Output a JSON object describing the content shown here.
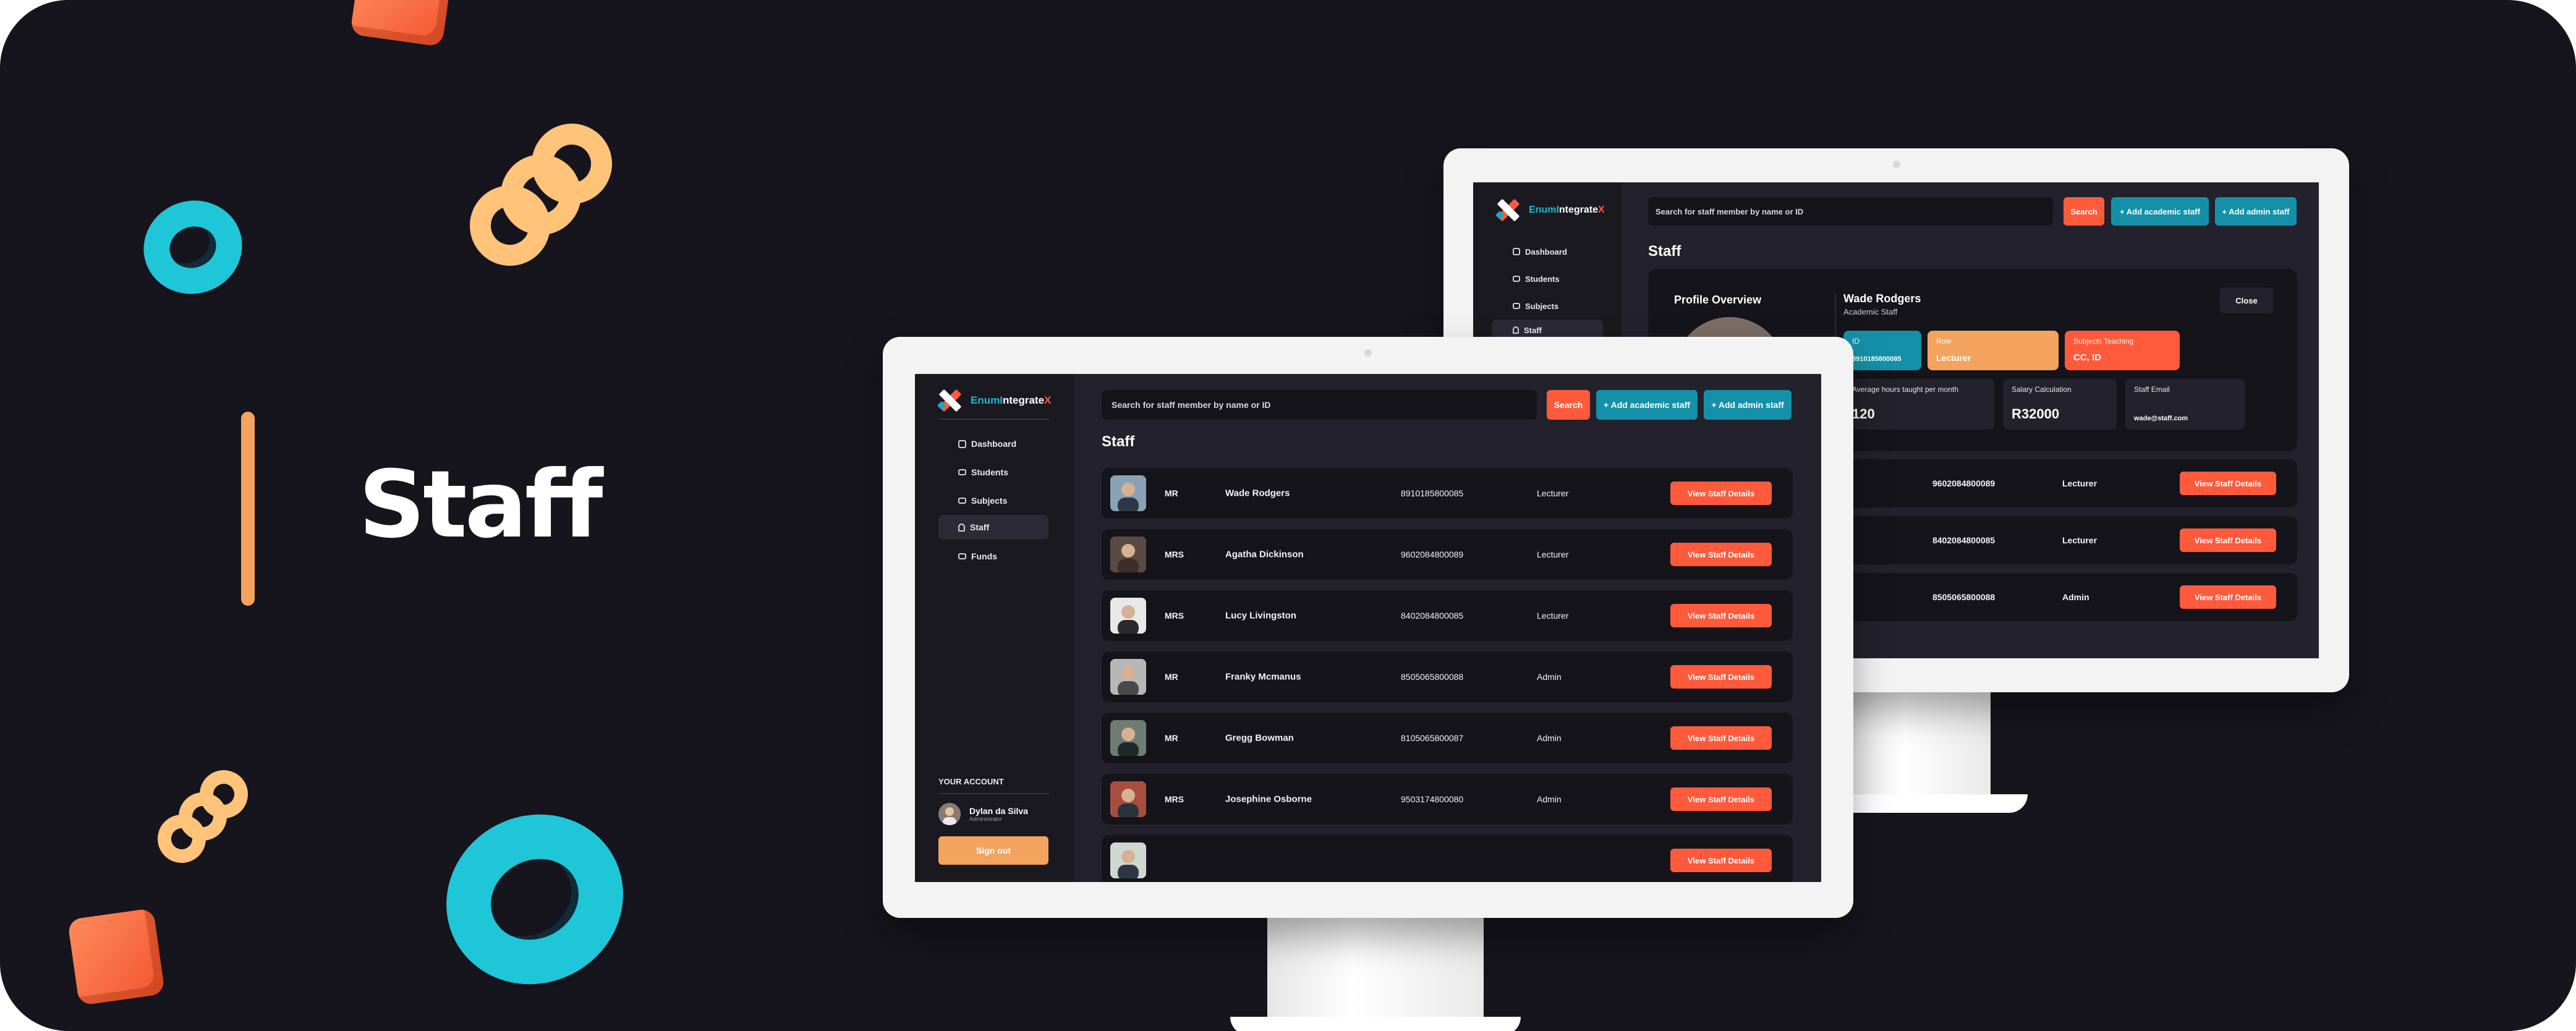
{
  "hero": {
    "title": "Staff"
  },
  "app": {
    "brand": {
      "part1": "Enum",
      "part2": "I",
      "part3": "ntegrate",
      "part4": "X"
    },
    "search": {
      "placeholder": "Search for staff member by name or ID",
      "button": "Search"
    },
    "actions": {
      "add_academic": "+ Add academic staff",
      "add_admin": "+ Add admin staff"
    },
    "page_title": "Staff",
    "nav": [
      {
        "label": "Dashboard",
        "icon": "grid-icon"
      },
      {
        "label": "Students",
        "icon": "graduation-cap-icon"
      },
      {
        "label": "Subjects",
        "icon": "book-icon"
      },
      {
        "label": "Staff",
        "icon": "person-icon"
      },
      {
        "label": "Funds",
        "icon": "wallet-icon"
      }
    ],
    "account": {
      "title": "YOUR ACCOUNT",
      "name": "Dylan da Silva",
      "role": "Administrator",
      "sign_out": "Sign out"
    },
    "view_button": "View Staff Details",
    "staff": [
      {
        "title": "MR",
        "name": "Wade Rodgers",
        "id": "8910185800085",
        "role": "Lecturer"
      },
      {
        "title": "MRS",
        "name": "Agatha Dickinson",
        "id": "9602084800089",
        "role": "Lecturer"
      },
      {
        "title": "MRS",
        "name": "Lucy Livingston",
        "id": "8402084800085",
        "role": "Lecturer"
      },
      {
        "title": "MR",
        "name": "Franky Mcmanus",
        "id": "8505065800088",
        "role": "Admin"
      },
      {
        "title": "MR",
        "name": "Gregg Bowman",
        "id": "8105065800087",
        "role": "Admin"
      },
      {
        "title": "MRS",
        "name": "Josephine Osborne",
        "id": "9503174800080",
        "role": "Admin"
      }
    ],
    "back_rows": [
      {
        "id": "9602084800089",
        "role": "Lecturer"
      },
      {
        "id": "8402084800085",
        "role": "Lecturer"
      },
      {
        "id": "8505065800088",
        "role": "Admin"
      }
    ],
    "profile": {
      "heading": "Profile Overview",
      "name": "Wade Rodgers",
      "subtitle": "Academic Staff",
      "close": "Close",
      "id_label": "ID",
      "id_value": "8910185800085",
      "role_label": "Role",
      "role_value": "Lecturer",
      "subjects_label": "Subjects Teaching",
      "subjects_value": "CC, ID",
      "hours_label": "Average hours taught per month",
      "hours_value": "120",
      "salary_label": "Salary Calculation",
      "salary_value": "R32000",
      "email_label": "Staff Email",
      "email_value": "wade@staff.com"
    }
  },
  "colors": {
    "background": "#16151e",
    "accent_orange": "#ff5a3c",
    "accent_teal": "#1491a8",
    "accent_sand": "#f4a35f",
    "cyan": "#1fc6d8"
  }
}
